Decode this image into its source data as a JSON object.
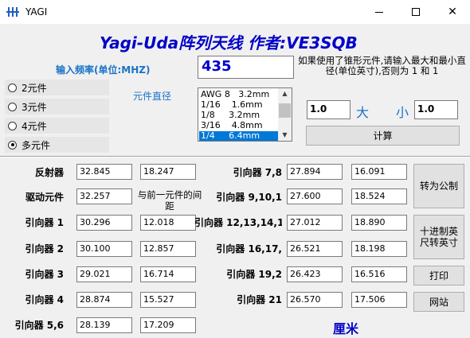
{
  "window": {
    "title": "YAGI"
  },
  "header": {
    "app_title": "Yagi-Uda阵列天线  作者:VE3SQB"
  },
  "frequency": {
    "label": "输入频率(单位:MHZ)",
    "value": "435"
  },
  "cone": {
    "note": "如果使用了锥形元件,请输入最大和最小直径(单位英寸),否则为 1 和 1",
    "max_label": "大",
    "min_label": "小",
    "max_value": "1.0",
    "min_value": "1.0"
  },
  "element_count": {
    "options": [
      "2元件",
      "3元件",
      "4元件",
      "多元件"
    ],
    "selected": "多元件"
  },
  "diameter": {
    "label": "元件直径",
    "options": [
      "AWG 8   3.2mm",
      "1/16    1.6mm",
      "1/8     3.2mm",
      "3/16    4.8mm",
      "1/4     6.4mm"
    ],
    "selected": "1/4     6.4mm"
  },
  "buttons": {
    "calculate": "计算",
    "to_metric": "转为公制",
    "decimal_inch": "十进制英尺转英寸",
    "print": "打印",
    "website": "网站"
  },
  "results_left": [
    {
      "label": "反射器",
      "length": "32.845",
      "spacing": "18.247"
    },
    {
      "label": "驱动元件",
      "length": "32.257",
      "spacing": "与前一元件的间距"
    },
    {
      "label": "引向器 1",
      "length": "30.296",
      "spacing": "12.018"
    },
    {
      "label": "引向器 2",
      "length": "30.100",
      "spacing": "12.857"
    },
    {
      "label": "引向器 3",
      "length": "29.021",
      "spacing": "16.714"
    },
    {
      "label": "引向器 4",
      "length": "28.874",
      "spacing": "15.527"
    },
    {
      "label": "引向器 5,6",
      "length": "28.139",
      "spacing": "17.209"
    }
  ],
  "results_right": [
    {
      "label": "引向器 7,8",
      "length": "27.894",
      "spacing": "16.091"
    },
    {
      "label": "引向器 9,10,1",
      "length": "27.600",
      "spacing": "18.524"
    },
    {
      "label": "引向器 12,13,14,1",
      "length": "27.012",
      "spacing": "18.890"
    },
    {
      "label": "引向器 16,17,",
      "length": "26.521",
      "spacing": "18.198"
    },
    {
      "label": "引向器 19,2",
      "length": "26.423",
      "spacing": "16.516"
    },
    {
      "label": "引向器 21",
      "length": "26.570",
      "spacing": "17.506"
    }
  ],
  "unit_label": "厘米"
}
